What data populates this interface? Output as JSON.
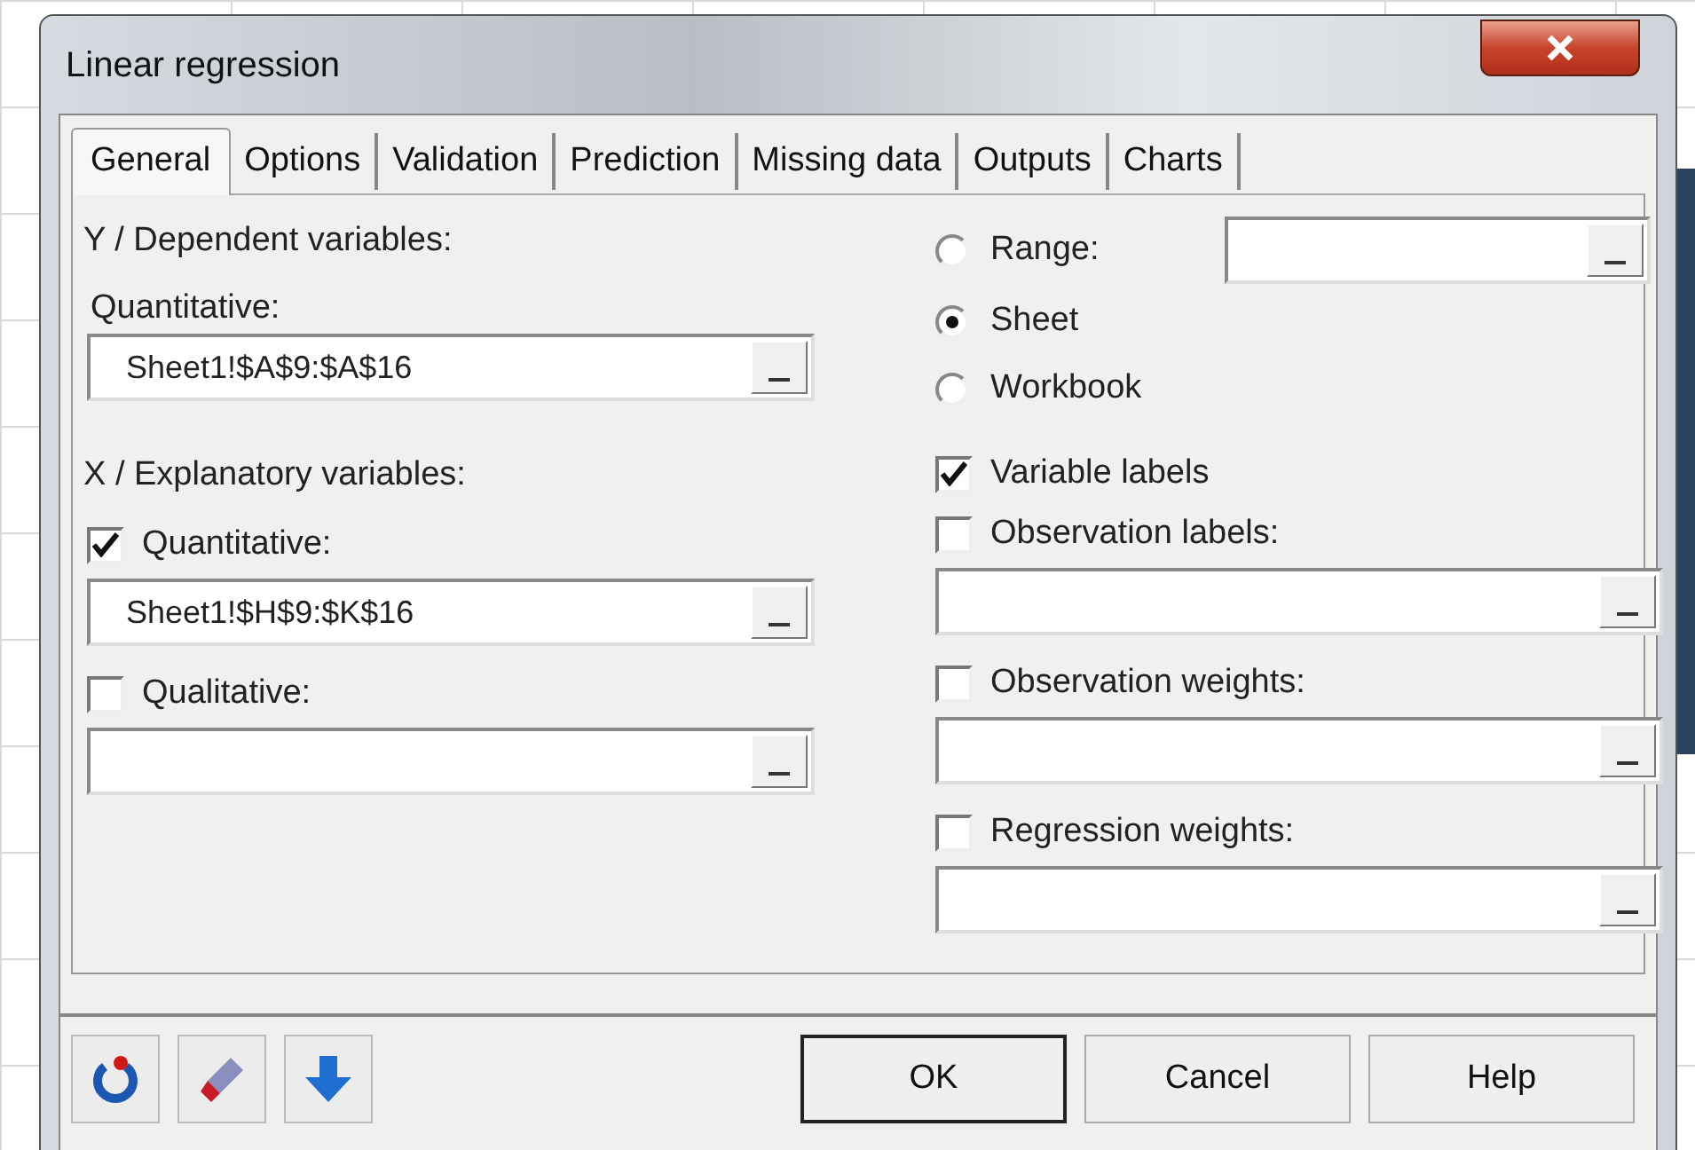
{
  "window": {
    "title": "Linear regression"
  },
  "tabs": [
    {
      "label": "General",
      "selected": true
    },
    {
      "label": "Options",
      "selected": false
    },
    {
      "label": "Validation",
      "selected": false
    },
    {
      "label": "Prediction",
      "selected": false
    },
    {
      "label": "Missing data",
      "selected": false
    },
    {
      "label": "Outputs",
      "selected": false
    },
    {
      "label": "Charts",
      "selected": false
    }
  ],
  "dependent": {
    "heading": "Y / Dependent variables:",
    "label": "Quantitative:",
    "value": "Sheet1!$A$9:$A$16"
  },
  "explanatory": {
    "heading": "X / Explanatory variables:",
    "options": [
      {
        "label": "Quantitative:",
        "checked": true,
        "value": "Sheet1!$H$9:$K$16"
      },
      {
        "label": "Qualitative:",
        "checked": false
      }
    ]
  },
  "scope": [
    {
      "label": "Range:",
      "selected": false,
      "kind": "field"
    },
    {
      "label": "Sheet",
      "selected": true,
      "kind": "plain"
    },
    {
      "label": "Workbook",
      "selected": false,
      "kind": "plain"
    }
  ],
  "labels": [
    {
      "label": "Variable labels",
      "checked": true,
      "kind": "plain"
    },
    {
      "label": "Observation labels:",
      "checked": false,
      "kind": "field"
    },
    {
      "label": "Observation weights:",
      "checked": false,
      "kind": "field"
    },
    {
      "label": "Regression weights:",
      "checked": false,
      "kind": "field"
    }
  ],
  "buttons": [
    {
      "label": "OK",
      "default": true
    },
    {
      "label": "Cancel",
      "default": false
    },
    {
      "label": "Help",
      "default": false
    }
  ]
}
